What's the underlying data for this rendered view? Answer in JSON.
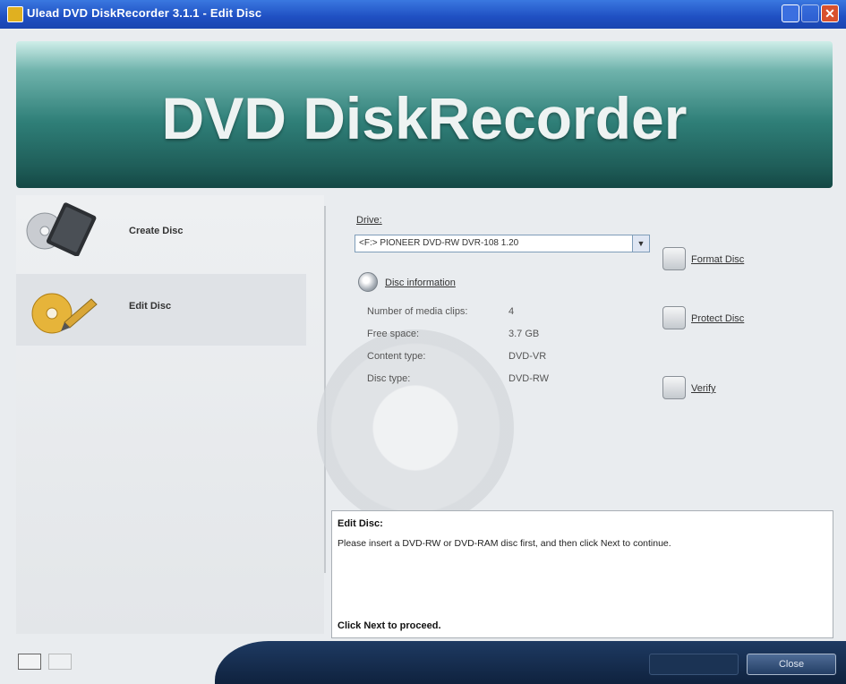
{
  "window": {
    "title": "Ulead DVD DiskRecorder 3.1.1 - Edit Disc",
    "close_glyph": "✕"
  },
  "banner": {
    "title": "DVD DiskRecorder"
  },
  "sidebar": {
    "items": [
      {
        "label": "Create Disc",
        "icon": "dvd-case-icon"
      },
      {
        "label": "Edit Disc",
        "icon": "edit-disc-icon"
      }
    ]
  },
  "drive": {
    "label": "Drive:",
    "value": "<F:> PIONEER DVD-RW DVR-108 1.20"
  },
  "disc_info": {
    "button_label": "Disc information",
    "rows": [
      {
        "label": "Number of media clips:",
        "value": "4"
      },
      {
        "label": "Free space:",
        "value": "3.7 GB"
      },
      {
        "label": "Content type:",
        "value": "DVD-VR"
      },
      {
        "label": "Disc type:",
        "value": "DVD-RW"
      }
    ]
  },
  "actions": {
    "format_label": "Format Disc",
    "protect_label": "Protect Disc",
    "verify_label": "Verify"
  },
  "description": {
    "title": "Edit Disc:",
    "text": "Please insert a DVD-RW or DVD-RAM disc first, and then click Next to continue.",
    "footer": "Click Next to proceed."
  },
  "footer": {
    "close_label": "Close"
  },
  "colors": {
    "titlebar": "#1f4fc2",
    "banner": "#2f7f78",
    "bottom_bar": "#0f223e"
  }
}
